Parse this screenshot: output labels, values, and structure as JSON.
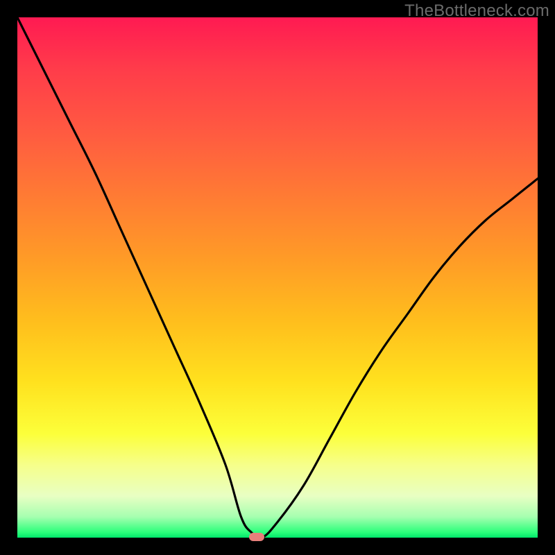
{
  "watermark": "TheBottleneck.com",
  "chart_data": {
    "type": "line",
    "title": "",
    "xlabel": "",
    "ylabel": "",
    "xlim": [
      0,
      100
    ],
    "ylim": [
      0,
      100
    ],
    "series": [
      {
        "name": "bottleneck-curve",
        "x": [
          0,
          5,
          10,
          15,
          20,
          25,
          30,
          35,
          40,
          43,
          45,
          47,
          50,
          55,
          60,
          65,
          70,
          75,
          80,
          85,
          90,
          95,
          100
        ],
        "y": [
          100,
          90,
          80,
          70,
          59,
          48,
          37,
          26,
          14,
          4,
          1,
          0,
          3,
          10,
          19,
          28,
          36,
          43,
          50,
          56,
          61,
          65,
          69
        ]
      }
    ],
    "marker": {
      "x": 46,
      "y": 0
    },
    "gradient_stops": [
      {
        "pos": 0,
        "color": "#ff1a52"
      },
      {
        "pos": 50,
        "color": "#ffbd1d"
      },
      {
        "pos": 80,
        "color": "#fcff3a"
      },
      {
        "pos": 100,
        "color": "#00e66b"
      }
    ]
  }
}
